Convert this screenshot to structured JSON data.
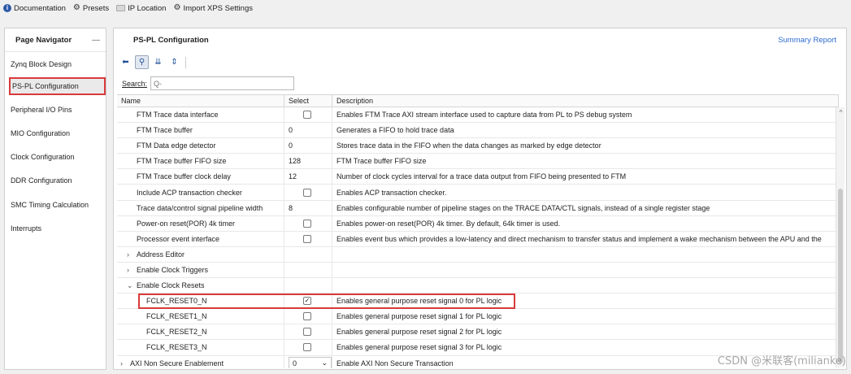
{
  "toolbar": {
    "documentation": "Documentation",
    "presets": "Presets",
    "ip_location": "IP Location",
    "import_xps": "Import XPS Settings"
  },
  "navigator": {
    "title": "Page Navigator",
    "minimize": "—",
    "items": [
      {
        "label": "Zynq Block Design",
        "selected": false
      },
      {
        "label": "PS-PL Configuration",
        "selected": true
      },
      {
        "label": "Peripheral I/O Pins",
        "selected": false
      },
      {
        "label": "MIO Configuration",
        "selected": false
      },
      {
        "label": "Clock Configuration",
        "selected": false
      },
      {
        "label": "DDR Configuration",
        "selected": false
      },
      {
        "label": "SMC Timing Calculation",
        "selected": false
      },
      {
        "label": "Interrupts",
        "selected": false
      }
    ]
  },
  "main": {
    "title": "PS-PL Configuration",
    "summary_link": "Summary Report",
    "search_label": "Search:",
    "search_placeholder": "Q-",
    "columns": [
      "Name",
      "Select",
      "Description"
    ]
  },
  "rows": [
    {
      "indent": 2,
      "name": "FTM Trace data interface",
      "select": "checkbox",
      "checked": false,
      "desc": "Enables FTM Trace AXI stream interface used to capture data from PL to PS debug system"
    },
    {
      "indent": 2,
      "name": "FTM Trace buffer",
      "select": "0",
      "desc": "Generates a FIFO to hold trace data"
    },
    {
      "indent": 2,
      "name": "FTM Data edge detector",
      "select": "0",
      "desc": "Stores trace data in the FIFO when the data changes as marked by edge detector"
    },
    {
      "indent": 2,
      "name": "FTM Trace buffer FIFO size",
      "select": "128",
      "desc": "FTM Trace buffer FIFO size"
    },
    {
      "indent": 2,
      "name": "FTM Trace buffer clock delay",
      "select": "12",
      "desc": "Number of clock cycles interval for a trace data output from FIFO being presented to FTM"
    },
    {
      "indent": 2,
      "name": "Include ACP transaction checker",
      "select": "checkbox",
      "checked": false,
      "desc": " Enables ACP transaction checker."
    },
    {
      "indent": 2,
      "name": "Trace data/control signal pipeline width",
      "select": "8",
      "desc": "Enables configurable number of pipeline stages on the TRACE DATA/CTL signals, instead of a single register stage"
    },
    {
      "indent": 2,
      "name": "Power-on reset(POR) 4k timer",
      "select": "checkbox",
      "checked": false,
      "desc": "Enables power-on reset(POR) 4k timer. By default, 64k timer is used."
    },
    {
      "indent": 2,
      "name": "Processor event interface",
      "select": "checkbox",
      "checked": false,
      "desc": "Enables event bus which provides a low-latency and direct mechanism to transfer status and implement a wake mechanism between the APU and the"
    },
    {
      "indent": 1,
      "group": ">",
      "name": "Address Editor",
      "select": "",
      "desc": ""
    },
    {
      "indent": 1,
      "group": ">",
      "name": "Enable Clock Triggers",
      "select": "",
      "desc": ""
    },
    {
      "indent": 1,
      "group": "v",
      "name": "Enable Clock Resets",
      "select": "",
      "desc": ""
    },
    {
      "indent": 3,
      "name": "FCLK_RESET0_N",
      "select": "checkbox",
      "checked": true,
      "desc": "Enables general purpose reset signal 0 for PL logic"
    },
    {
      "indent": 3,
      "name": "FCLK_RESET1_N",
      "select": "checkbox",
      "checked": false,
      "desc": "Enables general purpose reset signal 1 for PL logic"
    },
    {
      "indent": 3,
      "name": "FCLK_RESET2_N",
      "select": "checkbox",
      "checked": false,
      "desc": "Enables general purpose reset signal 2 for PL logic"
    },
    {
      "indent": 3,
      "name": "FCLK_RESET3_N",
      "select": "checkbox",
      "checked": false,
      "desc": "Enables general purpose reset signal 3 for PL logic"
    },
    {
      "indent": 0,
      "group": ">",
      "name": "AXI Non Secure Enablement",
      "select": "dropdown",
      "value": "0",
      "desc": "Enable AXI Non Secure Transaction"
    }
  ],
  "watermark": "CSDN @米联客(milianke)",
  "colors": {
    "highlight": "#d93a3a",
    "link": "#2d6bd0"
  }
}
